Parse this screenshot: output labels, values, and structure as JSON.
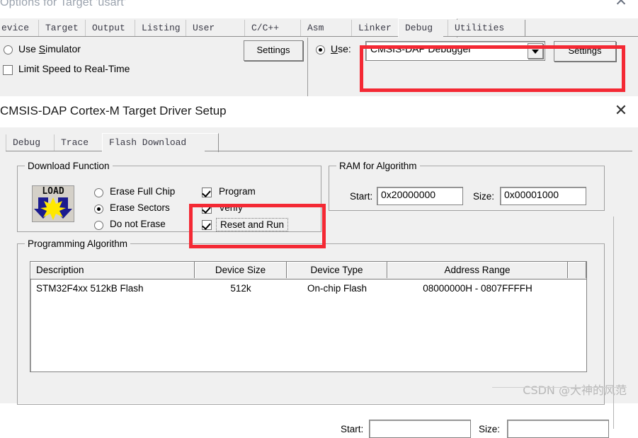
{
  "dialog1": {
    "title": "Options for Target 'usart'",
    "close_icon": "close-icon",
    "tabs": [
      {
        "label": "evice",
        "selected": false
      },
      {
        "label": "Target",
        "selected": false
      },
      {
        "label": "Output",
        "selected": false
      },
      {
        "label": "Listing",
        "selected": false
      },
      {
        "label": "User",
        "selected": false
      },
      {
        "label": "C/C++",
        "selected": false
      },
      {
        "label": "Asm",
        "selected": false
      },
      {
        "label": "Linker",
        "selected": false
      },
      {
        "label": "Debug",
        "selected": true
      },
      {
        "label": "Utilities",
        "selected": false
      }
    ],
    "left": {
      "use_simulator_label_pre": "Use ",
      "use_simulator_label_key": "S",
      "use_simulator_label_post": "imulator",
      "use_simulator_checked": false,
      "limit_speed_label": "Limit Speed to Real-Time",
      "limit_speed_checked": false,
      "settings_label": "Settings"
    },
    "right": {
      "use_radio_checked": true,
      "use_label_key": "U",
      "use_label_post": "se:",
      "debugger_value": "CMSIS-DAP Debugger",
      "dropdown_icon": "chevron-down-icon",
      "settings_label": "Settings"
    }
  },
  "dialog2": {
    "title": "CMSIS-DAP Cortex-M Target Driver Setup",
    "close_icon": "close-icon",
    "tabs": [
      {
        "label": "Debug",
        "selected": false
      },
      {
        "label": "Trace",
        "selected": false
      },
      {
        "label": "Flash Download",
        "selected": true
      }
    ],
    "download_function": {
      "group_label": "Download Function",
      "icon_text": "LOAD",
      "radios": [
        {
          "label": "Erase Full Chip",
          "checked": false
        },
        {
          "label": "Erase Sectors",
          "checked": true
        },
        {
          "label": "Do not Erase",
          "checked": false
        }
      ],
      "checkboxes": [
        {
          "label": "Program",
          "checked": true
        },
        {
          "label": "Verify",
          "checked": true
        },
        {
          "label": "Reset and Run",
          "checked": true,
          "focused": true
        }
      ]
    },
    "ram_for_algorithm": {
      "group_label": "RAM for Algorithm",
      "start_label": "Start:",
      "start_value": "0x20000000",
      "size_label": "Size:",
      "size_value": "0x00001000"
    },
    "programming_algorithm": {
      "group_label": "Programming Algorithm",
      "columns": [
        "Description",
        "Device Size",
        "Device Type",
        "Address Range",
        ""
      ],
      "rows": [
        [
          "STM32F4xx 512kB Flash",
          "512k",
          "On-chip Flash",
          "08000000H - 0807FFFFH",
          ""
        ]
      ]
    },
    "bottom_fields": {
      "start_label": "Start:",
      "start_value": "",
      "size_label": "Size:",
      "size_value": ""
    }
  },
  "watermark": {
    "text": "CSDN @大神的风范"
  },
  "colors": {
    "highlight": "#f42934",
    "dialog_bg": "#f0f0f0"
  }
}
